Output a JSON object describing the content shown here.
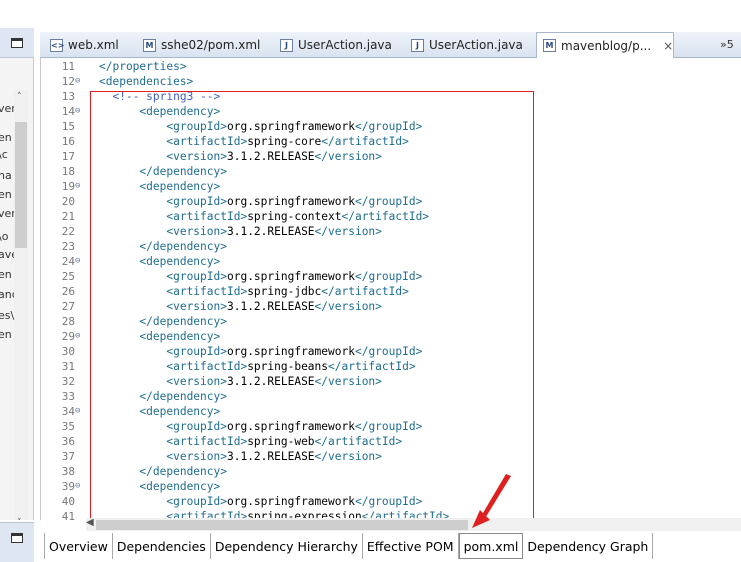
{
  "left_panel": {
    "fragments": [
      "ver",
      "en",
      "\\c",
      "na",
      "en",
      "ver",
      "\\o",
      "ave",
      "en",
      "anc",
      "es\\",
      "en"
    ],
    "minimize_label": "minimize"
  },
  "tabs": [
    {
      "label": "web.xml",
      "icon": "xml-file-icon"
    },
    {
      "label": "sshe02/pom.xml",
      "icon": "maven-pom-icon"
    },
    {
      "label": "UserAction.java",
      "icon": "java-file-icon"
    },
    {
      "label": "UserAction.java",
      "icon": "java-file-icon"
    },
    {
      "label": "mavenblog/p...",
      "icon": "maven-pom-icon",
      "active": true
    }
  ],
  "overflow_label": "»5",
  "code_lines": [
    {
      "n": "11",
      "fold": false,
      "indent": "",
      "parts": [
        [
          "tag",
          "</properties>"
        ]
      ]
    },
    {
      "n": "12",
      "fold": true,
      "indent": "",
      "parts": [
        [
          "tag",
          "<dependencies>"
        ]
      ]
    },
    {
      "n": "13",
      "fold": false,
      "indent": "  ",
      "parts": [
        [
          "cmt",
          "<!-- spring3 -->"
        ]
      ]
    },
    {
      "n": "14",
      "fold": true,
      "indent": "      ",
      "parts": [
        [
          "tag",
          "<dependency>"
        ]
      ]
    },
    {
      "n": "15",
      "fold": false,
      "indent": "          ",
      "parts": [
        [
          "tag",
          "<groupId>"
        ],
        [
          "txt",
          "org.springframework"
        ],
        [
          "tag",
          "</groupId>"
        ]
      ]
    },
    {
      "n": "16",
      "fold": false,
      "indent": "          ",
      "parts": [
        [
          "tag",
          "<artifactId>"
        ],
        [
          "txt",
          "spring-core"
        ],
        [
          "tag",
          "</artifactId>"
        ]
      ]
    },
    {
      "n": "17",
      "fold": false,
      "indent": "          ",
      "parts": [
        [
          "tag",
          "<version>"
        ],
        [
          "txt",
          "3.1.2.RELEASE"
        ],
        [
          "tag",
          "</version>"
        ]
      ]
    },
    {
      "n": "18",
      "fold": false,
      "indent": "      ",
      "parts": [
        [
          "tag",
          "</dependency>"
        ]
      ]
    },
    {
      "n": "19",
      "fold": true,
      "indent": "      ",
      "parts": [
        [
          "tag",
          "<dependency>"
        ]
      ]
    },
    {
      "n": "20",
      "fold": false,
      "indent": "          ",
      "parts": [
        [
          "tag",
          "<groupId>"
        ],
        [
          "txt",
          "org.springframework"
        ],
        [
          "tag",
          "</groupId>"
        ]
      ]
    },
    {
      "n": "21",
      "fold": false,
      "indent": "          ",
      "parts": [
        [
          "tag",
          "<artifactId>"
        ],
        [
          "txt",
          "spring-context"
        ],
        [
          "tag",
          "</artifactId>"
        ]
      ]
    },
    {
      "n": "22",
      "fold": false,
      "indent": "          ",
      "parts": [
        [
          "tag",
          "<version>"
        ],
        [
          "txt",
          "3.1.2.RELEASE"
        ],
        [
          "tag",
          "</version>"
        ]
      ]
    },
    {
      "n": "23",
      "fold": false,
      "indent": "      ",
      "parts": [
        [
          "tag",
          "</dependency>"
        ]
      ]
    },
    {
      "n": "24",
      "fold": true,
      "indent": "      ",
      "parts": [
        [
          "tag",
          "<dependency>"
        ]
      ]
    },
    {
      "n": "25",
      "fold": false,
      "indent": "          ",
      "parts": [
        [
          "tag",
          "<groupId>"
        ],
        [
          "txt",
          "org.springframework"
        ],
        [
          "tag",
          "</groupId>"
        ]
      ]
    },
    {
      "n": "26",
      "fold": false,
      "indent": "          ",
      "parts": [
        [
          "tag",
          "<artifactId>"
        ],
        [
          "txt",
          "spring-jdbc"
        ],
        [
          "tag",
          "</artifactId>"
        ]
      ]
    },
    {
      "n": "27",
      "fold": false,
      "indent": "          ",
      "parts": [
        [
          "tag",
          "<version>"
        ],
        [
          "txt",
          "3.1.2.RELEASE"
        ],
        [
          "tag",
          "</version>"
        ]
      ]
    },
    {
      "n": "28",
      "fold": false,
      "indent": "      ",
      "parts": [
        [
          "tag",
          "</dependency>"
        ]
      ]
    },
    {
      "n": "29",
      "fold": true,
      "indent": "      ",
      "parts": [
        [
          "tag",
          "<dependency>"
        ]
      ]
    },
    {
      "n": "30",
      "fold": false,
      "indent": "          ",
      "parts": [
        [
          "tag",
          "<groupId>"
        ],
        [
          "txt",
          "org.springframework"
        ],
        [
          "tag",
          "</groupId>"
        ]
      ]
    },
    {
      "n": "31",
      "fold": false,
      "indent": "          ",
      "parts": [
        [
          "tag",
          "<artifactId>"
        ],
        [
          "txt",
          "spring-beans"
        ],
        [
          "tag",
          "</artifactId>"
        ]
      ]
    },
    {
      "n": "32",
      "fold": false,
      "indent": "          ",
      "parts": [
        [
          "tag",
          "<version>"
        ],
        [
          "txt",
          "3.1.2.RELEASE"
        ],
        [
          "tag",
          "</version>"
        ]
      ]
    },
    {
      "n": "33",
      "fold": false,
      "indent": "      ",
      "parts": [
        [
          "tag",
          "</dependency>"
        ]
      ]
    },
    {
      "n": "34",
      "fold": true,
      "indent": "      ",
      "parts": [
        [
          "tag",
          "<dependency>"
        ]
      ]
    },
    {
      "n": "35",
      "fold": false,
      "indent": "          ",
      "parts": [
        [
          "tag",
          "<groupId>"
        ],
        [
          "txt",
          "org.springframework"
        ],
        [
          "tag",
          "</groupId>"
        ]
      ]
    },
    {
      "n": "36",
      "fold": false,
      "indent": "          ",
      "parts": [
        [
          "tag",
          "<artifactId>"
        ],
        [
          "txt",
          "spring-web"
        ],
        [
          "tag",
          "</artifactId>"
        ]
      ]
    },
    {
      "n": "37",
      "fold": false,
      "indent": "          ",
      "parts": [
        [
          "tag",
          "<version>"
        ],
        [
          "txt",
          "3.1.2.RELEASE"
        ],
        [
          "tag",
          "</version>"
        ]
      ]
    },
    {
      "n": "38",
      "fold": false,
      "indent": "      ",
      "parts": [
        [
          "tag",
          "</dependency>"
        ]
      ]
    },
    {
      "n": "39",
      "fold": true,
      "indent": "      ",
      "parts": [
        [
          "tag",
          "<dependency>"
        ]
      ]
    },
    {
      "n": "40",
      "fold": false,
      "indent": "          ",
      "parts": [
        [
          "tag",
          "<groupId>"
        ],
        [
          "txt",
          "org.springframework"
        ],
        [
          "tag",
          "</groupId>"
        ]
      ]
    },
    {
      "n": "41",
      "fold": false,
      "indent": "          ",
      "parts": [
        [
          "tag",
          "<artifactId>"
        ],
        [
          "txt",
          "spring-expression"
        ],
        [
          "tag",
          "</artifactId>"
        ]
      ]
    }
  ],
  "page_tabs": [
    {
      "label": "Overview"
    },
    {
      "label": "Dependencies"
    },
    {
      "label": "Dependency Hierarchy"
    },
    {
      "label": "Effective POM"
    },
    {
      "label": "pom.xml",
      "active": true
    },
    {
      "label": "Dependency Graph"
    }
  ],
  "colors": {
    "tag": "#1f6d8f",
    "comment": "#3f5fbf",
    "annotation_red": "#e02020"
  }
}
